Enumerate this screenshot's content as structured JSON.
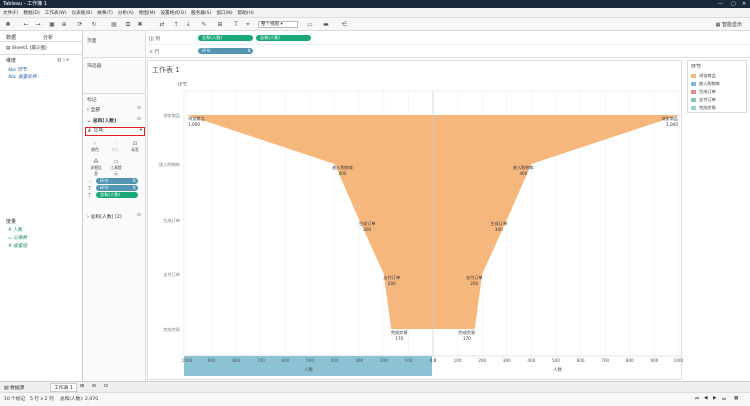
{
  "window": {
    "title": "Tableau - 工作簿 1"
  },
  "menu": [
    "文件(F)",
    "数据(D)",
    "工作表(W)",
    "仪表板(B)",
    "故事(T)",
    "分析(A)",
    "地图(M)",
    "设置格式(O)",
    "服务器(S)",
    "窗口(N)",
    "帮助(H)"
  ],
  "toolbar": {
    "view_select": "整个视图",
    "show_me": "智能显示"
  },
  "left_pane": {
    "tabs": [
      "数据",
      "分析"
    ],
    "source": "Sheet1 (漏斗图)",
    "dimensions_header": "维度",
    "dimensions": [
      "环节",
      "度量名称"
    ],
    "measures_header": "度量",
    "measures": [
      "人数",
      "记录数",
      "度量值"
    ]
  },
  "filters": {
    "pages_label": "页面",
    "filters_label": "筛选器",
    "marks_label": "标记",
    "all_label": "全部",
    "card1_label": "总和(人数)",
    "mark_type": "区域",
    "buttons": [
      "颜色",
      "大小",
      "标签",
      "详细信息",
      "工具提示"
    ],
    "pills": [
      "环节",
      "环节",
      "总和(人数)"
    ],
    "card2_label": "总和(人数) (2)"
  },
  "shelves": {
    "columns_label": "列",
    "rows_label": "行",
    "columns": [
      "总和(人数)",
      "总和(人数)"
    ],
    "rows": [
      "环节"
    ]
  },
  "worksheet": {
    "title": "工作表 1",
    "header": "环节"
  },
  "legend": {
    "title": "环节",
    "items": [
      {
        "label": "浏览商品",
        "color": "#f4b87a"
      },
      {
        "label": "放入购物车",
        "color": "#89b4d8"
      },
      {
        "label": "生成订单",
        "color": "#e78a8a"
      },
      {
        "label": "支付订单",
        "color": "#86c9a6"
      },
      {
        "label": "完成交易",
        "color": "#9dcfd6"
      }
    ]
  },
  "chart_data": {
    "type": "area",
    "categories": [
      "浏览商品",
      "放入购物车",
      "生成订单",
      "支付订单",
      "完成交易"
    ],
    "values": [
      1000,
      400,
      300,
      200,
      170
    ],
    "left_ticks": [
      "1000",
      "900",
      "800",
      "700",
      "600",
      "500",
      "400",
      "300",
      "200",
      "100",
      "0.0"
    ],
    "right_ticks": [
      "0.0",
      "100",
      "200",
      "300",
      "400",
      "500",
      "600",
      "700",
      "800",
      "900",
      "1000"
    ],
    "xlabel_left": "人数",
    "xlabel_right": "人数",
    "xlim": [
      0,
      1000
    ],
    "color": "#f6b77c",
    "grid": true
  },
  "bottom": {
    "tabs": [
      "数据源",
      "工作表 1"
    ]
  },
  "status": {
    "marks": "10 个标记",
    "rowscols": "5 行 x 2 列",
    "sum": "总和(人数): 2,070"
  }
}
